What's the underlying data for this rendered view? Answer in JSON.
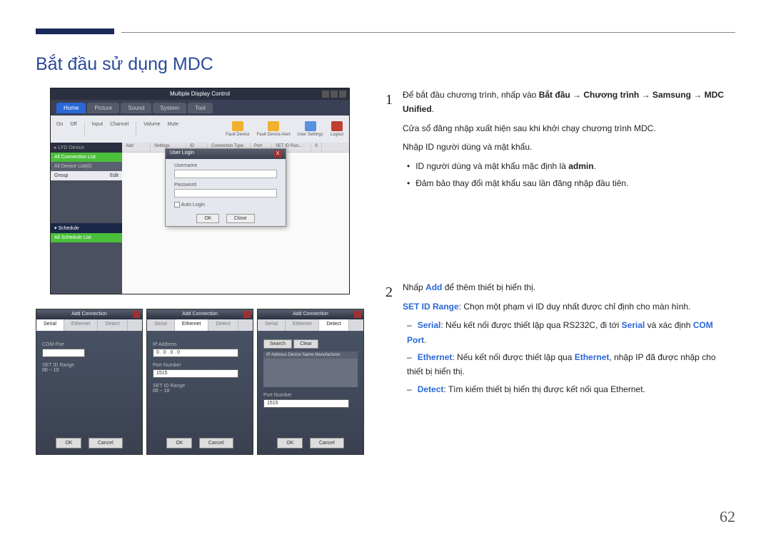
{
  "page": {
    "title": "Bắt đầu sử dụng MDC",
    "number": "62"
  },
  "mainshot": {
    "title": "Multiple Display Control",
    "tabs": [
      "Home",
      "Picture",
      "Sound",
      "System",
      "Tool"
    ],
    "tbar_icons": [
      "Fault Device",
      "Fault Device Alert",
      "User Settings",
      "Logout"
    ],
    "side": {
      "lfd": "▸ LFD Device",
      "conn": "All Connection List",
      "alllist": "All Device List(0)",
      "group": "Group",
      "edit": "Edit",
      "sched": "▾ Schedule",
      "schedlist": "All Schedule List"
    },
    "gridhdr": [
      "Add",
      "",
      "Settings",
      "ID",
      "",
      "Connection Type",
      "Port",
      "SET ID Ran...",
      "S"
    ],
    "login": {
      "title": "User Login",
      "user": "Username",
      "pass": "Password",
      "auto": "Auto Login",
      "close_btn": "X",
      "ok": "OK",
      "close": "Close"
    }
  },
  "smallshots": {
    "title": "Add Connection",
    "close": "X",
    "tabs": [
      "Serial",
      "Ethernet",
      "Detect"
    ],
    "s1": {
      "active": "Serial",
      "f1": "COM Port",
      "f2": "SET ID Range",
      "range": "00 ~ 10"
    },
    "s2": {
      "active": "Ethernet",
      "f1": "IP Address",
      "ip": "0 . 0 . 0 . 0",
      "f2": "Port Number",
      "pv": "1515",
      "f3": "SET ID Range",
      "range": "00 ~ 10"
    },
    "s3": {
      "active": "Detect",
      "search": "Search",
      "clear": "Clear",
      "cols": "IP Address     Device Name     Manufacturer",
      "f2": "Port Number",
      "pv": "1515"
    },
    "ok": "OK",
    "cancel": "Cancel"
  },
  "steps": {
    "s1": {
      "num": "1",
      "l1a": "Để bắt đầu chương trình, nhấp vào ",
      "l1b": "Bắt đầu → Chương trình → Samsung → MDC Unified",
      "l2": "Cửa sổ đăng nhập xuất hiện sau khi khởi chạy chương trình MDC.",
      "l3": "Nhập ID người dùng và mật khẩu.",
      "b1a": "ID người dùng và mật khẩu mặc định là ",
      "b1b": "admin",
      "b2": "Đảm bảo thay đổi mật khẩu sau lần đăng nhập đầu tiên."
    },
    "s2": {
      "num": "2",
      "l1a": "Nhấp ",
      "l1b": "Add",
      "l1c": " để thêm thiết bị hiển thị.",
      "l2a": "SET ID Range",
      "l2b": ": Chọn một phạm vi ID duy nhất được chỉ định cho màn hình.",
      "d1a": "Serial",
      "d1b": ": Nếu kết nối được thiết lập qua RS232C, đi tới ",
      "d1c": "Serial",
      "d1d": " và xác định ",
      "d1e": "COM Port",
      "d2a": "Ethernet",
      "d2b": ": Nếu kết nối được thiết lập qua ",
      "d2c": "Ethernet",
      "d2d": ", nhập IP đã được nhập cho thiết bị hiển thị.",
      "d3a": "Detect",
      "d3b": ": Tìm kiếm thiết bị hiển thị được kết nối qua Ethernet."
    }
  }
}
